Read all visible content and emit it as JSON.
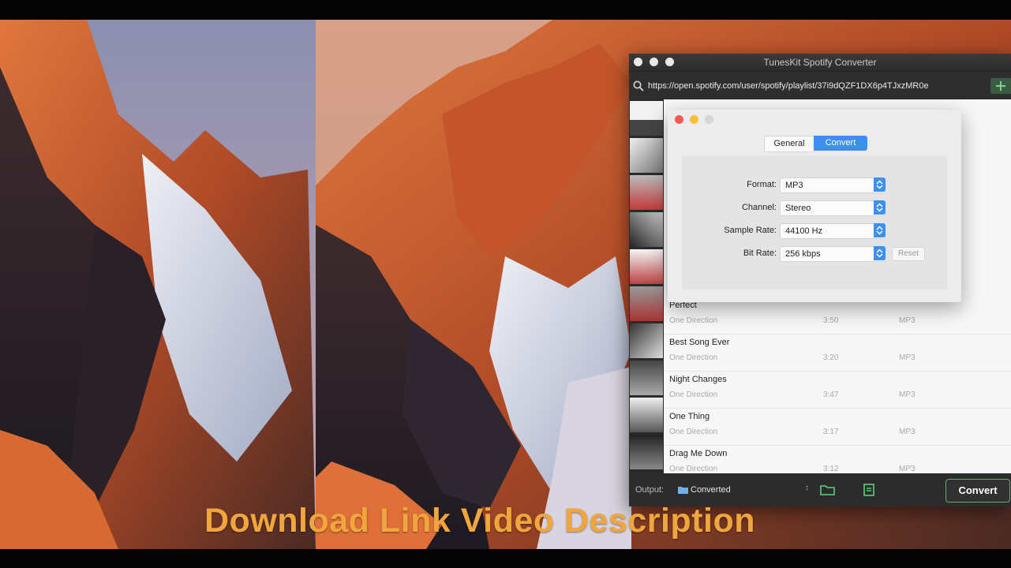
{
  "window": {
    "title": "TunesKit Spotify Converter"
  },
  "url_bar": {
    "value": "https://open.spotify.com/user/spotify/playlist/37i9dQZF1DX6p4TJxzMR0e",
    "search_icon": "search-icon",
    "add_icon": "add-icon"
  },
  "prefs": {
    "tabs": {
      "general": "General",
      "convert": "Convert",
      "active": "Convert"
    },
    "fields": {
      "format": {
        "label": "Format:",
        "value": "MP3"
      },
      "channel": {
        "label": "Channel:",
        "value": "Stereo"
      },
      "sample_rate": {
        "label": "Sample Rate:",
        "value": "44100 Hz"
      },
      "bit_rate": {
        "label": "Bit Rate:",
        "value": "256 kbps"
      }
    },
    "reset_label": "Reset"
  },
  "tracks": [
    {
      "title": "Perfect",
      "artist": "One Direction",
      "duration": "3:50",
      "format": "MP3"
    },
    {
      "title": "Best Song Ever",
      "artist": "One Direction",
      "duration": "3:20",
      "format": "MP3"
    },
    {
      "title": "Night Changes",
      "artist": "One Direction",
      "duration": "3:47",
      "format": "MP3"
    },
    {
      "title": "One Thing",
      "artist": "One Direction",
      "duration": "3:17",
      "format": "MP3"
    },
    {
      "title": "Drag Me Down",
      "artist": "One Direction",
      "duration": "3:12",
      "format": "MP3"
    }
  ],
  "output": {
    "label": "Output:",
    "value": "Converted"
  },
  "convert_button": "Convert",
  "caption": "Download Link Video Description",
  "colors": {
    "accent": "#3d8ff0",
    "caption": "#f0a63c",
    "convert_border": "#6ea67a"
  }
}
